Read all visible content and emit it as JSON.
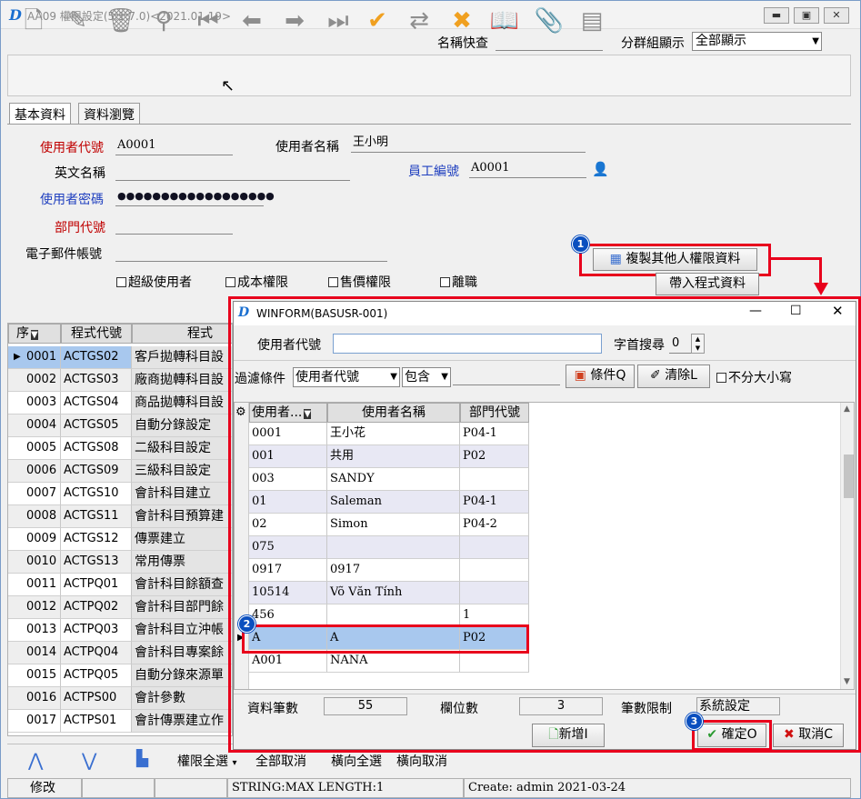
{
  "window": {
    "title": "AA09 權限設定(5.1.7.0)<2021.01.19>",
    "logo": "D"
  },
  "header": {
    "name_search_label": "名稱快查",
    "group_label": "分群組顯示",
    "group_value": "全部顯示"
  },
  "tabs": [
    {
      "label": "基本資料"
    },
    {
      "label": "資料瀏覽"
    }
  ],
  "form": {
    "user_code_label": "使用者代號",
    "user_code": "A0001",
    "user_name_label": "使用者名稱",
    "user_name": "王小明",
    "eng_name_label": "英文名稱",
    "eng_name": "",
    "emp_no_label": "員工編號",
    "emp_no": "A0001",
    "password_label": "使用者密碼",
    "password": "●●●●●●●●●●●●●●●●●●",
    "dept_label": "部門代號",
    "dept": "",
    "email_label": "電子郵件帳號",
    "email": "",
    "checkboxes": [
      "超級使用者",
      "成本權限",
      "售價權限",
      "離職"
    ]
  },
  "buttons": {
    "copy_perm": "複製其他人權限資料",
    "bring_program": "帶入程式資料"
  },
  "badges": [
    "1",
    "2",
    "3"
  ],
  "main_grid": {
    "headers": [
      "序",
      "程式代號",
      "程式"
    ],
    "rows": [
      [
        "0001",
        "ACTGS02",
        "客戶拋轉科目設"
      ],
      [
        "0002",
        "ACTGS03",
        "廠商拋轉科目設"
      ],
      [
        "0003",
        "ACTGS04",
        "商品拋轉科目設"
      ],
      [
        "0004",
        "ACTGS05",
        "自動分錄設定"
      ],
      [
        "0005",
        "ACTGS08",
        "二級科目設定"
      ],
      [
        "0006",
        "ACTGS09",
        "三級科目設定"
      ],
      [
        "0007",
        "ACTGS10",
        "會計科目建立"
      ],
      [
        "0008",
        "ACTGS11",
        "會計科目預算建"
      ],
      [
        "0009",
        "ACTGS12",
        "傳票建立"
      ],
      [
        "0010",
        "ACTGS13",
        "常用傳票"
      ],
      [
        "0011",
        "ACTPQ01",
        "會計科目餘額查"
      ],
      [
        "0012",
        "ACTPQ02",
        "會計科目部門餘"
      ],
      [
        "0013",
        "ACTPQ03",
        "會計科目立沖帳"
      ],
      [
        "0014",
        "ACTPQ04",
        "會計科目專案餘"
      ],
      [
        "0015",
        "ACTPQ05",
        "自動分錄來源單"
      ],
      [
        "0016",
        "ACTPS00",
        "會計參數"
      ],
      [
        "0017",
        "ACTPS01",
        "會計傳票建立作"
      ]
    ]
  },
  "bottom_bar": {
    "perm_all": "權限全選",
    "cancel_all": "全部取消",
    "horiz_all": "橫向全選",
    "horiz_cancel": "橫向取消"
  },
  "status_bar": {
    "mode": "修改",
    "info": "STRING:MAX LENGTH:1",
    "create": "Create: admin 2021-03-24"
  },
  "dialog": {
    "title": "WINFORM(BASUSR-001)",
    "user_code_label": "使用者代號",
    "user_code": "",
    "first_char_label": "字首搜尋",
    "first_char_value": "0",
    "filter_label": "過濾條件",
    "filter_field": "使用者代號",
    "filter_op": "包含",
    "filter_value": "",
    "cond_btn": "條件Q",
    "clear_btn": "清除L",
    "case_label": "不分大小寫",
    "headers": [
      "使用者...",
      "使用者名稱",
      "部門代號"
    ],
    "rows": [
      [
        "0001",
        "王小花",
        "P04-1"
      ],
      [
        "001",
        "共用",
        "P02"
      ],
      [
        "003",
        "SANDY",
        ""
      ],
      [
        "01",
        "Saleman",
        "P04-1"
      ],
      [
        "02",
        "Simon",
        "P04-2"
      ],
      [
        "075",
        "",
        ""
      ],
      [
        "0917",
        "0917",
        ""
      ],
      [
        "10514",
        "Võ Văn Tính",
        ""
      ],
      [
        "456",
        "",
        "1"
      ],
      [
        "A",
        "A",
        "P02"
      ],
      [
        "A001",
        "NANA",
        ""
      ]
    ],
    "record_count_label": "資料筆數",
    "record_count": "55",
    "field_count_label": "欄位數",
    "field_count": "3",
    "limit_label": "筆數限制",
    "limit_value": "系統設定",
    "add_btn": "新增I",
    "ok_btn": "確定O",
    "cancel_btn": "取消C"
  },
  "colors": {
    "accent_red": "#e8001c",
    "selection": "#a8c8ee",
    "badge_blue": "#0a4fbf"
  }
}
